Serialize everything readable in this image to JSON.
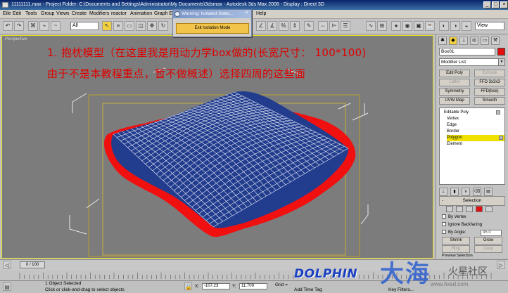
{
  "window": {
    "title": "11111111.max    - Project Folder: C:\\Documents and Settings\\Administrator\\My Documents\\3dsmax     - Autodesk 3ds Max 2008     - Display : Direct 3D"
  },
  "menu": [
    "Eile",
    "Edit",
    "Tools",
    "Group",
    "Views",
    "Create",
    "Modifiers",
    "reactor",
    "Animation",
    "Graph Ed",
    "Help"
  ],
  "toolbar": {
    "filter_select": "All",
    "view_select": "View"
  },
  "warning": {
    "title": "Warning: Isolated Selec...",
    "button": "Exit Isolation Mode"
  },
  "viewport": {
    "label": "Perspective",
    "annotation_line1": "1. 抱枕模型（在这里我是用动力学box做的(长宽尺寸：  100*100)",
    "annotation_line2": "由于不是本教程重点，暂不做概述）选择四周的这些面"
  },
  "command_panel": {
    "object_name": "Box01",
    "object_color": "#e01010",
    "modifier_list": "Modifier List",
    "buttons": [
      {
        "label": "Edit Poly",
        "enabled": true
      },
      {
        "label": "Extrude",
        "enabled": false
      },
      {
        "label": "Lathe",
        "enabled": false
      },
      {
        "label": "FFD 3x3x3",
        "enabled": true
      },
      {
        "label": "Symmetry",
        "enabled": true
      },
      {
        "label": "FFD(box)",
        "enabled": true
      },
      {
        "label": "UVW Map",
        "enabled": true
      },
      {
        "label": "Smooth",
        "enabled": true
      }
    ],
    "stack": {
      "root": "Editable Poly",
      "items": [
        {
          "label": "Vertex",
          "selected": false
        },
        {
          "label": "Edge",
          "selected": false
        },
        {
          "label": "Border",
          "selected": false
        },
        {
          "label": "Polygon",
          "selected": true
        },
        {
          "label": "Element",
          "selected": false
        }
      ]
    },
    "selection": {
      "title": "Selection",
      "by_vertex": "By Vertex",
      "ignore_backfacing": "Ignore Backfacing",
      "by_angle": "By Angle:",
      "angle_value": "45.0",
      "shrink": "Shrink",
      "grow": "Grow",
      "ring": "Ring",
      "loop": "Loop",
      "preview_selection": "Preview Selection"
    }
  },
  "timeline": {
    "frame": "0 / 100"
  },
  "status": {
    "selected": "1 Object Selected",
    "prompt": "Click or click-and-drag to select objects",
    "x_label": "X:",
    "x_value": "-107.23",
    "y_label": "Y:",
    "y_value": "11.709",
    "grid_label": "Grid =",
    "add_time_tag": "Add Time Tag",
    "key_filters": "Key Filters..."
  },
  "watermark": {
    "brand": "DOLPHIN",
    "cn": "大海",
    "forum": "火星社区",
    "url": "www.hxsd.com"
  }
}
